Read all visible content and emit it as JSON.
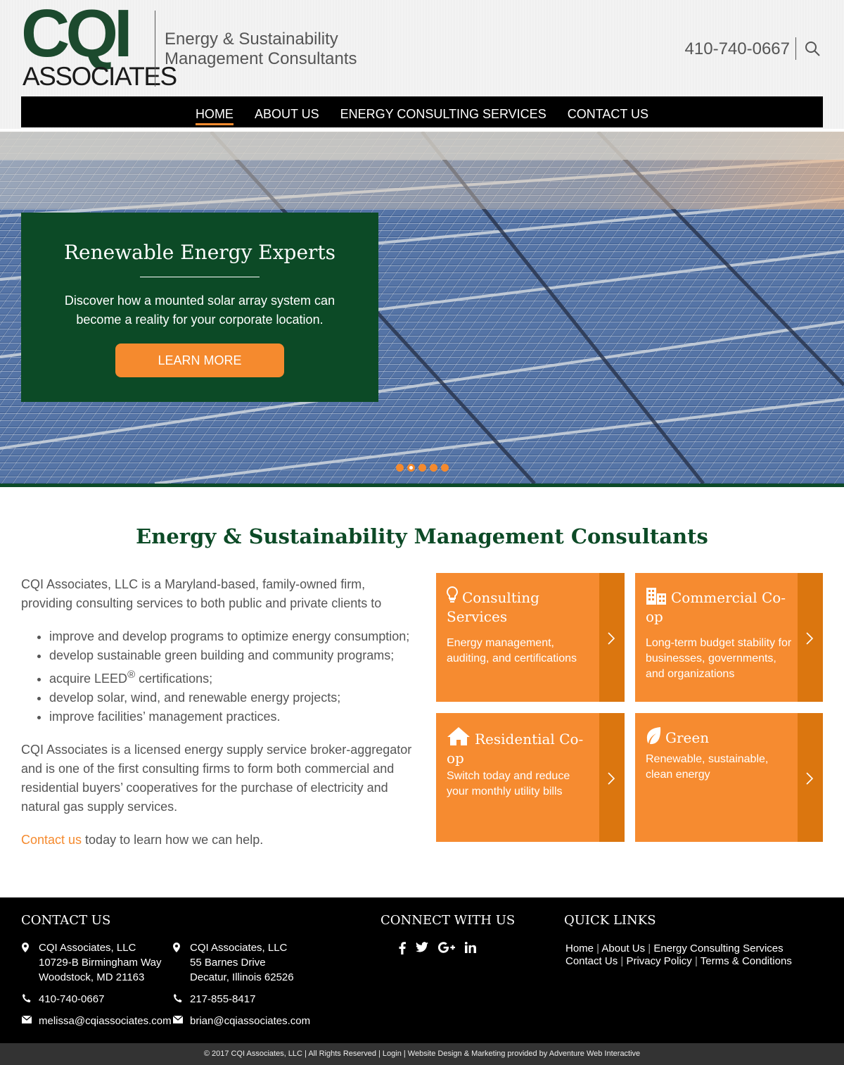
{
  "header": {
    "logo_top": "CQI",
    "logo_bottom": "ASSOCIATES",
    "tagline_line1": "Energy & Sustainability",
    "tagline_line2": "Management Consultants",
    "phone": "410-740-0667"
  },
  "nav": {
    "items": [
      {
        "label": "HOME"
      },
      {
        "label": "ABOUT US"
      },
      {
        "label": "ENERGY CONSULTING SERVICES"
      },
      {
        "label": "CONTACT US"
      }
    ]
  },
  "hero": {
    "title": "Renewable Energy Experts",
    "text": "Discover how a mounted solar array system can become a reality for your corporate location.",
    "button": "LEARN MORE",
    "slide_count": 5,
    "active_slide": 2
  },
  "main": {
    "title": "Energy & Sustainability Management Consultants",
    "intro": "CQI Associates, LLC is a Maryland-based, family-owned firm, providing consulting services to both public and private clients to",
    "bullets": [
      "improve and develop programs to optimize energy consumption;",
      "develop sustainable green building and community programs;",
      "acquire LEED",
      "develop solar, wind, and renewable energy projects;",
      "improve facilities’ management practices."
    ],
    "leed_sup": "®",
    "leed_after": " certifications;",
    "para2": "CQI Associates is a licensed energy supply service broker-aggregator and is one of the first consulting firms to form both commercial and residential buyers’ cooperatives for the purchase of electricity and natural gas supply services.",
    "contact_link": "Contact us",
    "contact_after": " today to learn how we can help."
  },
  "tiles": [
    {
      "title": "Consulting Services",
      "text": "Energy management, auditing, and certifications",
      "icon": "lightbulb-icon"
    },
    {
      "title": "Commercial Co-op",
      "text": "Long-term budget stability for businesses, governments, and organizations",
      "icon": "buildings-icon"
    },
    {
      "title": "Residential Co-op",
      "text": "Switch today and reduce your monthly utility bills",
      "icon": "house-icon"
    },
    {
      "title": "Green",
      "text": "Renewable, sustainable, clean energy",
      "icon": "leaf-icon"
    }
  ],
  "footer": {
    "contact_heading": "CONTACT US",
    "office1": {
      "name": "CQI Associates, LLC",
      "street": "10729-B Birmingham Way",
      "city": "Woodstock, MD 21163",
      "phone": "410-740-0667",
      "email": "melissa@cqiassociates.com"
    },
    "office2": {
      "name": "CQI Associates, LLC",
      "street": "55 Barnes Drive",
      "city": "Decatur, Illinois 62526",
      "phone": "217-855-8417",
      "email": "brian@cqiassociates.com"
    },
    "connect_heading": "CONNECT WITH US",
    "quick_heading": "QUICK LINKS",
    "quick_links": [
      "Home",
      "About Us",
      "Energy Consulting Services",
      "Contact Us",
      "Privacy Policy",
      "Terms & Conditions"
    ],
    "copyright": "© 2017 CQI Associates, LLC  |  All Rights Reserved  |  Login  |  Website Design & Marketing provided by Adventure Web Interactive"
  },
  "colors": {
    "green": "#0c4a26",
    "orange": "#f58a2e",
    "orange_dark": "#db760f"
  }
}
